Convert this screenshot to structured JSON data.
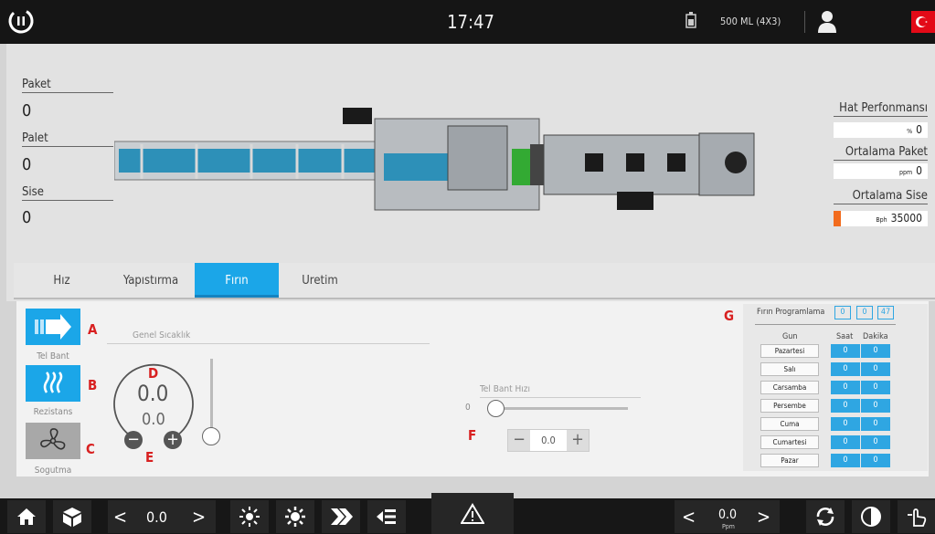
{
  "header": {
    "time": "17:47",
    "product": "500 ML  (4X3)"
  },
  "counters": [
    {
      "label": "Paket",
      "value": "0"
    },
    {
      "label": "Palet",
      "value": "0"
    },
    {
      "label": "Sise",
      "value": "0"
    }
  ],
  "performance": {
    "line_label": "Hat Perfonmansı",
    "line_unit": "%",
    "line_value": "0",
    "avg_pack_label": "Ortalama Paket",
    "avg_pack_unit": "ppm",
    "avg_pack_value": "0",
    "avg_bottle_label": "Ortalama Sise",
    "avg_bottle_unit": "Bph",
    "avg_bottle_value": "35000",
    "avg_bottle_fill": 0.08,
    "fill_color": "#f26b1d"
  },
  "tabs": [
    "Hız",
    "Yapıstırma",
    "Fırın",
    "Uretim"
  ],
  "active_tab": 2,
  "side_buttons": [
    {
      "label": "Tel Bant",
      "letter": "A"
    },
    {
      "label": "Rezistans",
      "letter": "B"
    },
    {
      "label": "Sogutma",
      "letter": "C"
    }
  ],
  "temp": {
    "title": "Genel Sıcaklık",
    "actual": "0.0",
    "set": "0.0",
    "letter_d": "D",
    "letter_e": "E",
    "setpoint_level": 0
  },
  "belt": {
    "title": "Tel Bant Hızı",
    "min": "0",
    "value": "0.0",
    "letter": "F",
    "slider_level": 0
  },
  "program": {
    "letter": "G",
    "title": "Fırın Programlama",
    "h": "0",
    "m": "0",
    "s": "47",
    "col_day": "Gun",
    "col_hour": "Saat",
    "col_min": "Dakika",
    "days": [
      {
        "name": "Pazartesi",
        "h": "0",
        "m": "0"
      },
      {
        "name": "Salı",
        "h": "0",
        "m": "0"
      },
      {
        "name": "Carsamba",
        "h": "0",
        "m": "0"
      },
      {
        "name": "Persembe",
        "h": "0",
        "m": "0"
      },
      {
        "name": "Cuma",
        "h": "0",
        "m": "0"
      },
      {
        "name": "Cumartesi",
        "h": "0",
        "m": "0"
      },
      {
        "name": "Pazar",
        "h": "0",
        "m": "0"
      }
    ]
  },
  "footer": {
    "speed_value": "0.0",
    "ppm_value": "0.0",
    "ppm_unit": "Ppm"
  },
  "colors": {
    "accent": "#1ba6e8",
    "red": "#d82020",
    "topbar": "#151515"
  }
}
